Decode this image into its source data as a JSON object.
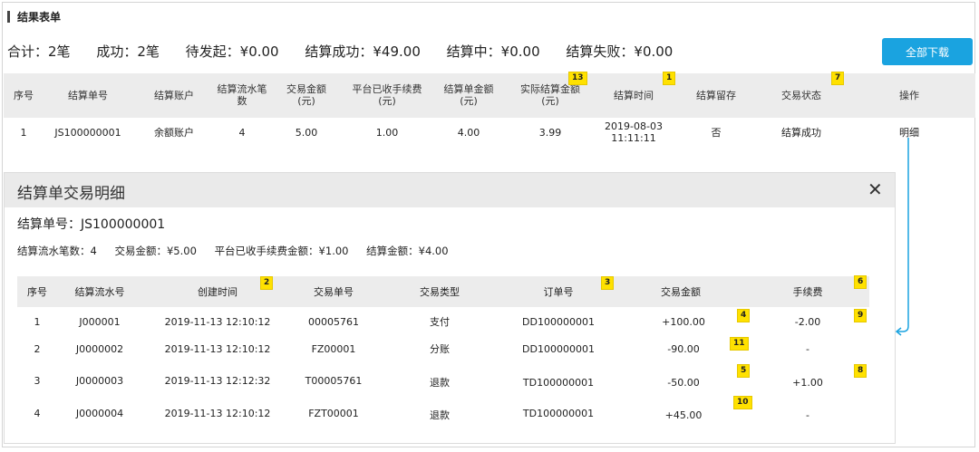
{
  "section_title": "结果表单",
  "summary": {
    "total": "合计：2笔",
    "success": "成功：2笔",
    "pending": "待发起：¥0.00",
    "settled_ok": "结算成功：¥49.00",
    "settling": "结算中：¥0.00",
    "settle_fail": "结算失败：¥0.00"
  },
  "download_label": "全部下载",
  "main_table": {
    "headers": [
      "序号",
      "结算单号",
      "结算账户",
      "结算流水笔\n数",
      "交易金额\n(元)",
      "平台已收手续费\n(元)",
      "结算单金额\n(元)",
      "实际结算金额\n(元)",
      "结算时间",
      "结算留存",
      "交易状态",
      "操作"
    ],
    "rows": [
      [
        "1",
        "JS100000001",
        "余额账户",
        "4",
        "5.00",
        "1.00",
        "4.00",
        "3.99",
        "2019-08-03\n11:11:11",
        "否",
        "结算成功",
        "明细"
      ]
    ],
    "badges": [
      "13",
      "1",
      "7"
    ]
  },
  "detail": {
    "title": "结算单交易明细",
    "close": "✕",
    "order_no": "结算单号：JS100000001",
    "summary": {
      "count": "结算流水笔数：4",
      "amount": "交易金额：¥5.00",
      "fee": "平台已收手续费金额：¥1.00",
      "settle": "结算金额：¥4.00"
    },
    "headers": [
      "序号",
      "结算流水号",
      "创建时间",
      "交易单号",
      "交易类型",
      "订单号",
      "交易金额",
      "手续费"
    ],
    "header_badges": [
      "2",
      "3",
      "6"
    ],
    "rows": [
      [
        "1",
        "J000001",
        "2019-11-13 12:10:12",
        "00005761",
        "支付",
        "DD100000001",
        "+100.00",
        "-2.00"
      ],
      [
        "2",
        "J0000002",
        "2019-11-13 12:10:12",
        "FZ00001",
        "分账",
        "DD100000001",
        "-90.00",
        "-"
      ],
      [
        "3",
        "J0000003",
        "2019-11-13 12:12:32",
        "T00005761",
        "退款",
        "TD100000001",
        "-50.00",
        "+1.00"
      ],
      [
        "4",
        "J0000004",
        "2019-11-13 12:10:12",
        "FZT00001",
        "退款",
        "TD100000001",
        "+45.00",
        "-"
      ]
    ],
    "row_badges": [
      [
        "4",
        "9"
      ],
      [
        "11",
        ""
      ],
      [
        "5",
        "8"
      ],
      [
        "10",
        ""
      ]
    ]
  },
  "colors": {
    "accent": "#1aa3e0",
    "link": "#2db33a",
    "badge": "#ffe100"
  }
}
